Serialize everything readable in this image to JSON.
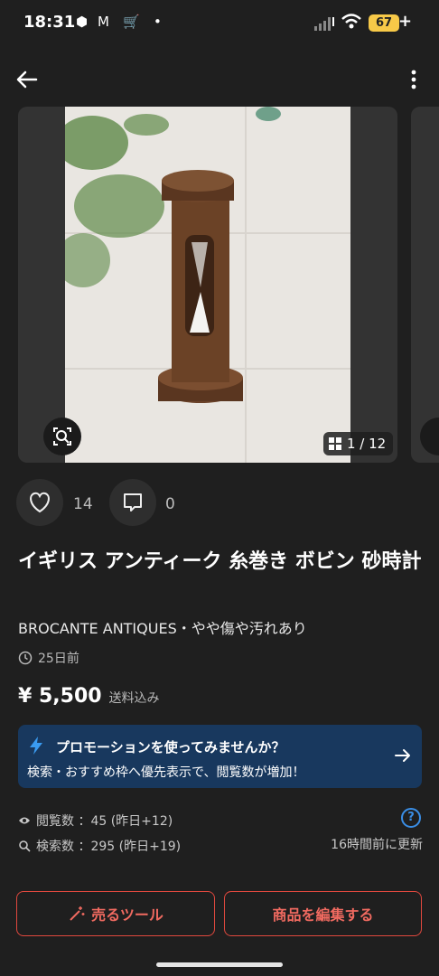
{
  "status_bar": {
    "time": "18:31",
    "battery": "67"
  },
  "gallery": {
    "counter": "1 / 12"
  },
  "actions": {
    "likes": "14",
    "comments": "0"
  },
  "item": {
    "title": "イギリス アンティーク 糸巻き ボビン 砂時計",
    "subtitle": "BROCANTE ANTIQUES・やや傷や汚れあり",
    "posted": "25日前",
    "price": "¥ 5,500",
    "shipping": "送料込み"
  },
  "promo": {
    "title": "プロモーションを使ってみませんか？",
    "body": "検索・おすすめ枠へ優先表示で、閲覧数が増加！"
  },
  "stats": {
    "views": "閲覧数 ：45 (昨日+12)",
    "searches": "検索数 ：295 (昨日+19)",
    "updated": "16時間前に更新"
  },
  "buttons": {
    "sell_tools": "売るツール",
    "edit_item": "商品を編集する"
  },
  "colors": {
    "accent": "#e0483e",
    "promo_bg": "#18385e",
    "background": "#1f1f1f"
  }
}
